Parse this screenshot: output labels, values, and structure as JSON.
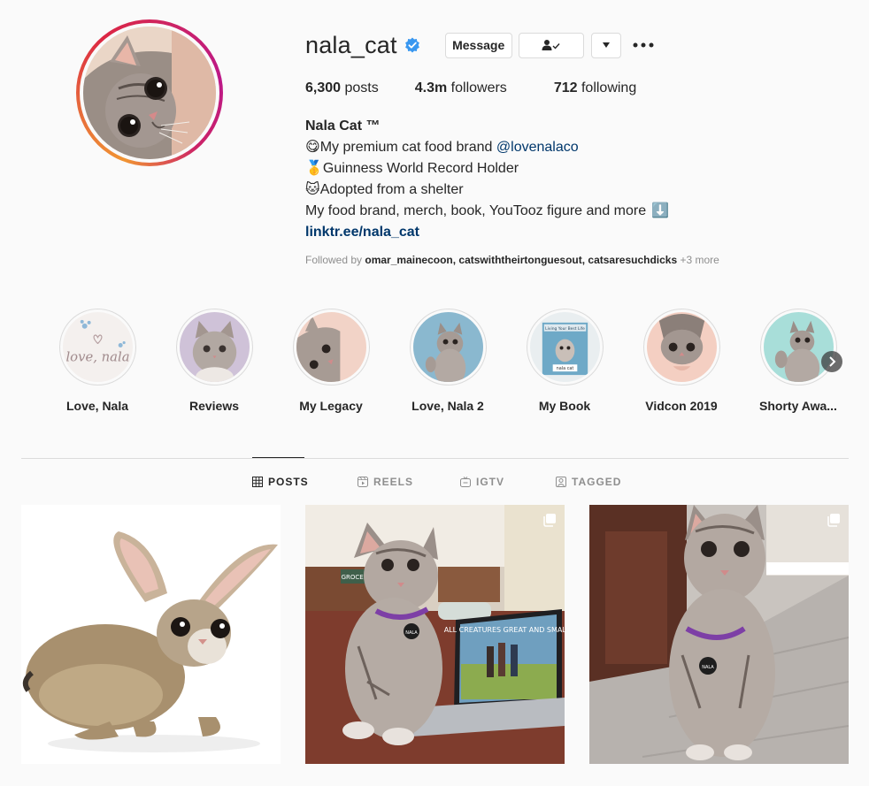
{
  "profile": {
    "username": "nala_cat",
    "verified": true,
    "buttons": {
      "message": "Message",
      "follow_state": "following-person-check-icon",
      "caret": "caret-down-icon",
      "more": "more-horizontal-icon"
    },
    "stats": {
      "posts_count": "6,300",
      "posts_label": "posts",
      "followers_count": "4.3m",
      "followers_label": "followers",
      "following_count": "712",
      "following_label": "following"
    },
    "bio": {
      "name": "Nala Cat ™",
      "line1_emoji": "😋",
      "line1_text": "My premium cat food brand ",
      "line1_mention": "@lovenalaco",
      "line2_emoji": "🥇",
      "line2_text": "Guinness World Record Holder",
      "line3_emoji": "🐱",
      "line3_text": "Adopted from a shelter",
      "line4_text": "My food brand, merch, book, YouTooz figure and more",
      "line4_emoji": "⬇️",
      "link": "linktr.ee/nala_cat"
    },
    "followed_by": {
      "prefix": "Followed by ",
      "users": "omar_mainecoon, catswiththeirtonguesout, catsaresuchdicks",
      "more": " +3 more"
    }
  },
  "highlights": [
    {
      "label": "Love, Nala"
    },
    {
      "label": "Reviews"
    },
    {
      "label": "My Legacy"
    },
    {
      "label": "Love, Nala 2"
    },
    {
      "label": "My Book"
    },
    {
      "label": "Vidcon 2019"
    },
    {
      "label": "Shorty Awa..."
    }
  ],
  "highlight_art": {
    "love_nala_logo": "love, nala",
    "book_cover_title": "Living Your Best Life",
    "book_cover_author": "nala cat"
  },
  "tabs": [
    {
      "label": "POSTS",
      "icon": "grid-icon",
      "active": true
    },
    {
      "label": "REELS",
      "icon": "reels-icon",
      "active": false
    },
    {
      "label": "IGTV",
      "icon": "igtv-icon",
      "active": false
    },
    {
      "label": "TAGGED",
      "icon": "tagged-icon",
      "active": false
    }
  ],
  "posts": [
    {
      "description": "bunny-cat",
      "multi": false
    },
    {
      "description": "cat-with-laptop",
      "multi": true,
      "laptop_title": "ALL CREATURES GREAT AND SMALL",
      "tag_text": "NALA",
      "sign_text": "GROCERY"
    },
    {
      "description": "cat-looking-up",
      "multi": true,
      "tag_text": "NALA"
    }
  ],
  "colors": {
    "text": "#262626",
    "secondary": "#8e8e8e",
    "link": "#00376b",
    "verified": "#3897f0",
    "border": "#dbdbdb",
    "background": "#fafafa"
  }
}
